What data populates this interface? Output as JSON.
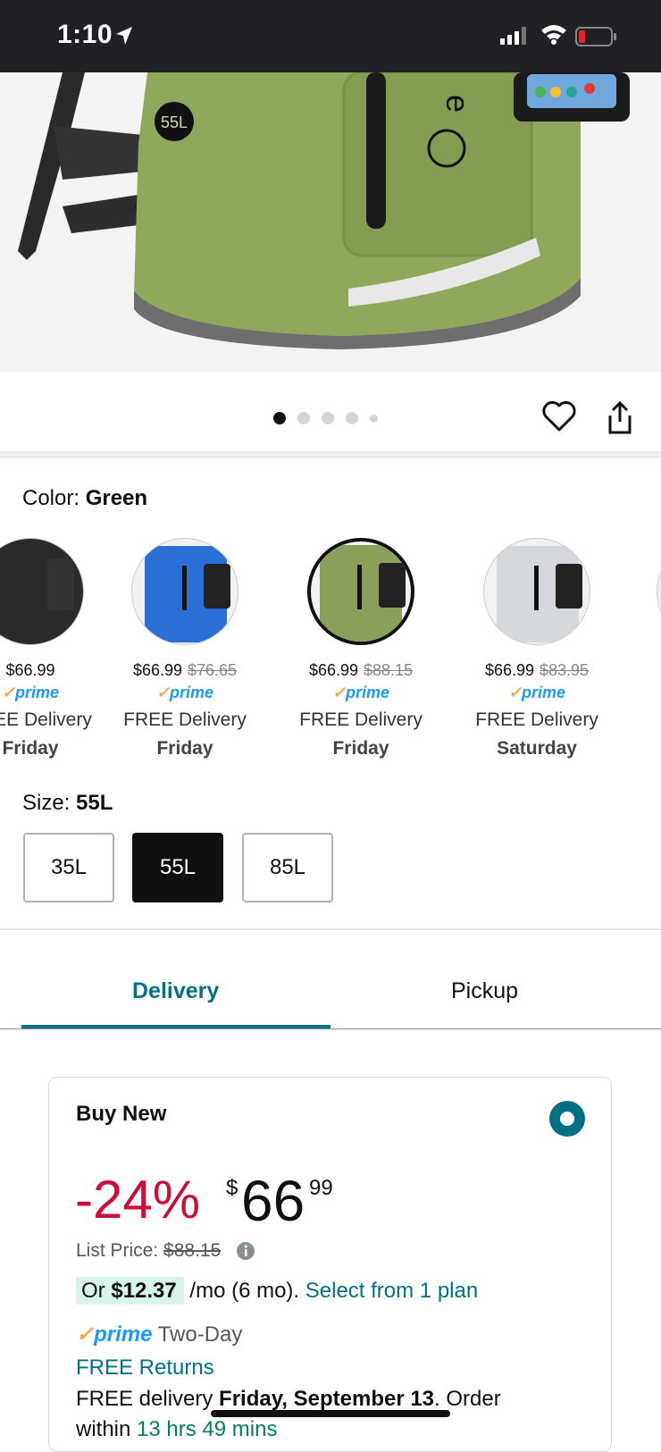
{
  "status_bar": {
    "time": "1:10"
  },
  "hero": {
    "product_badge": "55L"
  },
  "gallery": {
    "image_count": 5,
    "active_index": 0
  },
  "color": {
    "label": "Color: ",
    "value": "Green"
  },
  "swatches": [
    {
      "price": "$66.99",
      "list": "",
      "prime": "prime",
      "delivery": "FREE Delivery",
      "day": "Friday",
      "color": "#2b2b2b"
    },
    {
      "price": "$66.99",
      "list": "$76.65",
      "prime": "prime",
      "delivery": "FREE Delivery",
      "day": "Friday",
      "color": "#2a6fd6"
    },
    {
      "price": "$66.99",
      "list": "$88.15",
      "prime": "prime",
      "delivery": "FREE Delivery",
      "day": "Friday",
      "color": "#8aa05a"
    },
    {
      "price": "$66.99",
      "list": "$83.95",
      "prime": "prime",
      "delivery": "FREE Delivery",
      "day": "Saturday",
      "color": "#d5d8dc"
    }
  ],
  "size": {
    "label": "Size: ",
    "value": "55L",
    "options": [
      "35L",
      "55L",
      "85L"
    ]
  },
  "tabs": {
    "delivery": "Delivery",
    "pickup": "Pickup"
  },
  "buy": {
    "title": "Buy New",
    "discount": "-24%",
    "currency": "$",
    "price_whole": "66",
    "price_fraction": "99",
    "list_label": "List Price: ",
    "list_price": "$88.15",
    "plan_or": "Or ",
    "plan_amount": "$12.37",
    "plan_term": " /mo (6 mo). ",
    "plan_link": "Select from 1 plan",
    "prime_check": "✓",
    "prime_logo": "prime",
    "prime_speed": " Two-Day",
    "returns": "FREE Returns",
    "free_delivery_prefix": "FREE delivery ",
    "free_delivery_date": "Friday, September 13",
    "free_delivery_suffix": ". Order",
    "within_prefix": "within ",
    "within_time": "13 hrs 49 mins"
  },
  "colors": {
    "accent": "#007185",
    "discount": "#cc0c39",
    "prime": "#1a98ff"
  }
}
